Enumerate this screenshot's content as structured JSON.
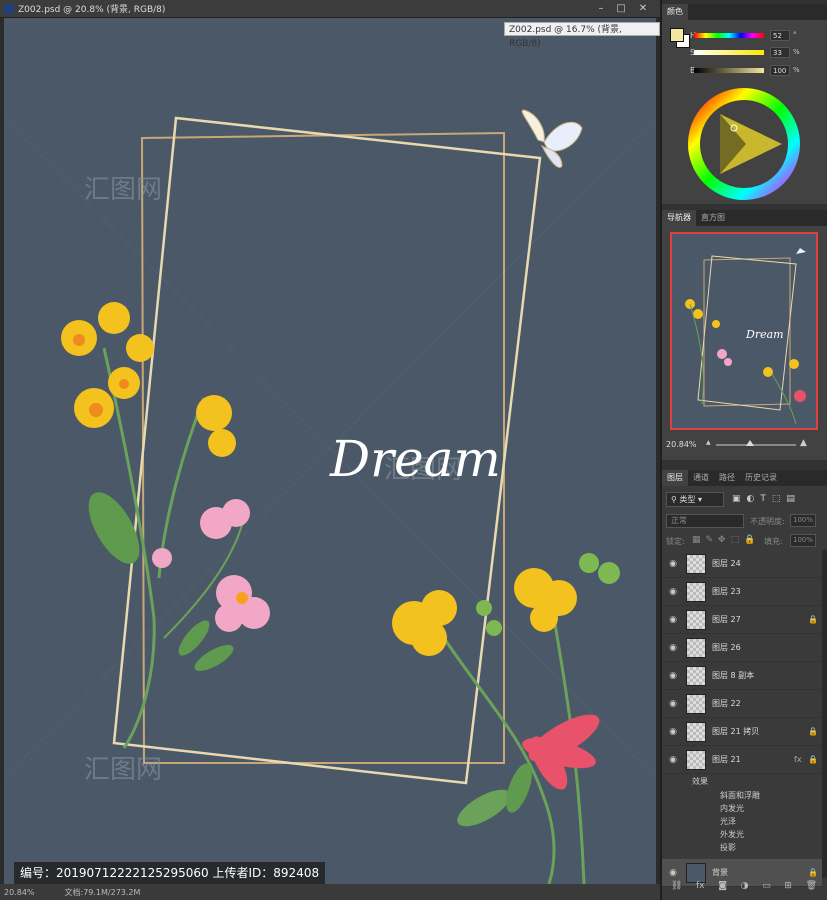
{
  "document": {
    "title": "Z002.psd @ 20.8% (背景, RGB/8)",
    "tooltip": "Z002.psd @ 16.7% (背景, RGB/8)",
    "canvas_color": "#4b5867",
    "artwork_text": "Dream",
    "watermark": "编号：20190712222125295060 上传者ID：892408",
    "status_zoom": "20.84%",
    "status_doc": "文档:79.1M/273.2M"
  },
  "window_buttons": {
    "minimize": "–",
    "maximize": "□",
    "close": "✕"
  },
  "color_panel": {
    "tab": "颜色",
    "fg_color": "#f3e6a0",
    "bg_color": "#ffffff",
    "h_label": "H",
    "h_value": "52",
    "h_unit": "°",
    "s_label": "S",
    "s_value": "33",
    "s_unit": "%",
    "b_label": "B",
    "b_value": "100",
    "b_unit": "%"
  },
  "navigator_panel": {
    "tabs": [
      "导航器",
      "直方图"
    ],
    "zoom": "20.84%",
    "preview_text": "Dream"
  },
  "layers_panel": {
    "tabs": [
      "图层",
      "通道",
      "路径",
      "历史记录"
    ],
    "filter_label": "类型",
    "blend_mode": "正常",
    "opacity_label": "不透明度:",
    "opacity_value": "100%",
    "lock_label": "锁定:",
    "fill_label": "填充:",
    "fill_value": "100%",
    "layers": [
      {
        "name": "图层 24",
        "locked": false
      },
      {
        "name": "图层 23",
        "locked": false
      },
      {
        "name": "图层 27",
        "locked": true
      },
      {
        "name": "图层 26",
        "locked": false
      },
      {
        "name": "图层 8 副本",
        "locked": false
      },
      {
        "name": "图层 22",
        "locked": false
      },
      {
        "name": "图层 21 拷贝",
        "locked": true
      },
      {
        "name": "图层 21",
        "locked": true,
        "fx": "fx"
      }
    ],
    "effects_label": "效果",
    "effects": [
      "斜面和浮雕",
      "内发光",
      "光泽",
      "外发光",
      "投影"
    ],
    "background_layer": "背景"
  }
}
